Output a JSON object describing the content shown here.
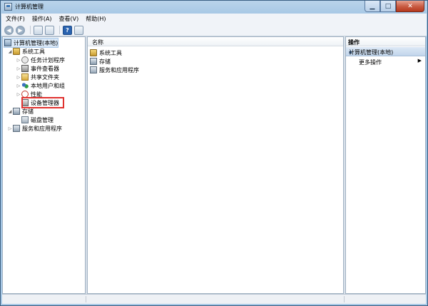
{
  "window": {
    "title": "计算机管理"
  },
  "menu": [
    "文件(F)",
    "操作(A)",
    "查看(V)",
    "帮助(H)"
  ],
  "toolbar": {
    "back_icon": "back-arrow-icon",
    "forward_icon": "forward-arrow-icon",
    "help_label": "?"
  },
  "tree": {
    "root": "计算机管理(本地)",
    "system_tools": "系统工具",
    "task_scheduler": "任务计划程序",
    "event_viewer": "事件查看器",
    "shared_folders": "共享文件夹",
    "local_users": "本地用户和组",
    "performance": "性能",
    "device_manager": "设备管理器",
    "storage": "存储",
    "disk_management": "磁盘管理",
    "services_apps": "服务和应用程序"
  },
  "list": {
    "column_name": "名称",
    "items": [
      "系统工具",
      "存储",
      "服务和应用程序"
    ]
  },
  "actions": {
    "header": "操作",
    "section": "计算机管理(本地)",
    "more_actions": "更多操作"
  },
  "colors": {
    "highlight_box": "#e0322f",
    "close_button": "#c85a41"
  }
}
